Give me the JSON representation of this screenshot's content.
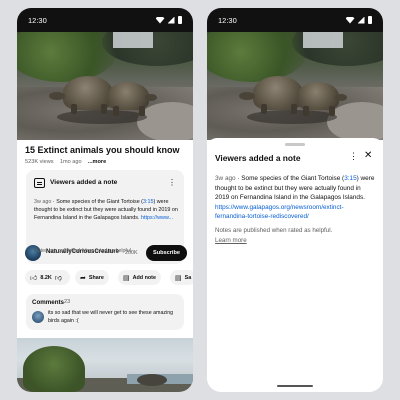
{
  "status_bar": {
    "time": "12:30"
  },
  "video": {
    "title": "15 Extinct animals you should know",
    "views": "523K views",
    "age": "1mo ago",
    "more_label": "...more"
  },
  "note_card": {
    "header": "Viewers added a note",
    "age": "3w ago",
    "separator": " · ",
    "body_before": "Some species of the Giant Tortoise (",
    "body_ref": "3:15",
    "body_after": ") were thought to be extinct but they were actually found in 2019 on Fernandina Island in the Galapagos Islands. ",
    "body_link": "https://www...",
    "footer": "Notes are published when rated as helpful.",
    "footer_link": "Learn more"
  },
  "channel": {
    "name": "NaturallyCuriousCreature",
    "subscribers": "200K",
    "subscribe_label": "Subscribe"
  },
  "actions": {
    "like_count": "8.2K",
    "share_label": "Share",
    "add_note_label": "Add note",
    "save_label": "Sa"
  },
  "comments": {
    "title": "Comments",
    "count": "23",
    "top_comment": "its so sad that we will never get to see these amazing birds again :("
  },
  "sheet": {
    "title": "Viewers added a note",
    "age": "3w ago",
    "separator": " · ",
    "body_before": "Some species of the Giant Tortoise (",
    "body_ref": "3:15",
    "body_after": ") were thought to be extinct but they were actually found in 2019 on Fernandina Island in the Galapagos Islands. ",
    "body_link": "https://www.galapagos.org/newsroom/extinct-fernandina-tortoise-rediscovered/",
    "footer": "Notes are published when rated as helpful.",
    "footer_link": "Learn more"
  },
  "colors": {
    "link": "#065fd4",
    "chip_bg": "#f2f2f2",
    "status_bar_bg": "#111111",
    "page_bg": "#dedfe3"
  },
  "icons": [
    "wifi-icon",
    "signal-icon",
    "battery-icon",
    "note-icon",
    "more-vert-icon",
    "like-icon",
    "dislike-icon",
    "share-icon",
    "add-note-icon",
    "save-icon",
    "close-icon"
  ]
}
